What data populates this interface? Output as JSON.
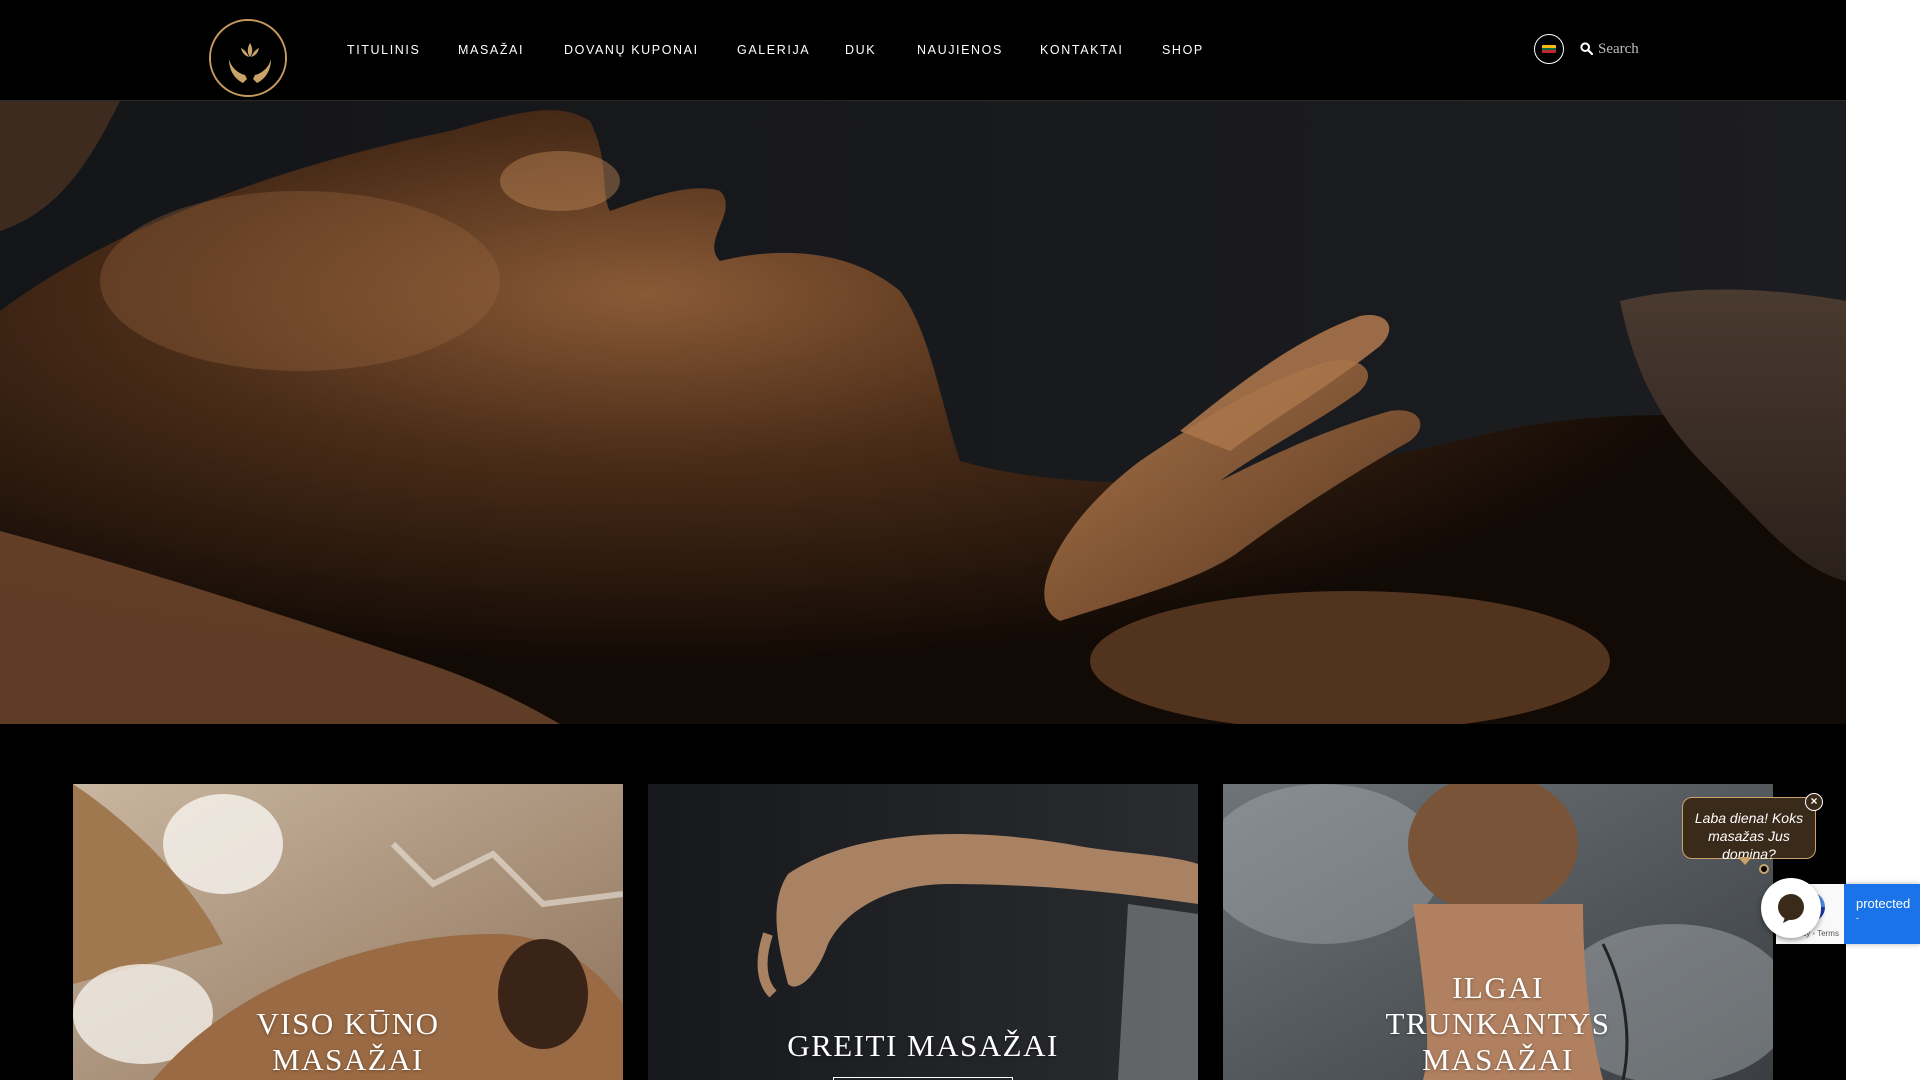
{
  "header": {
    "nav": [
      {
        "label": "TITULINIS"
      },
      {
        "label": "MASAŽAI"
      },
      {
        "label": "DOVANŲ KUPONAI"
      },
      {
        "label": "GALERIJA"
      },
      {
        "label": "DUK"
      },
      {
        "label": "NAUJIENOS"
      },
      {
        "label": "KONTAKTAI"
      },
      {
        "label": "SHOP"
      }
    ],
    "language_flag_colors": [
      "#fdb913",
      "#006a44",
      "#c1272d"
    ],
    "search": {
      "placeholder": "Search",
      "icon": "search-icon"
    },
    "logo_icon": "lotus-hands-icon"
  },
  "colors": {
    "accent_gold": "#c9a36a",
    "background": "#000000",
    "chat_bg": "#3a2a1a",
    "recaptcha_blue": "#1a73e8"
  },
  "cards": [
    {
      "title_lines": [
        "VISO KŪNO",
        "MASAŽAI"
      ]
    },
    {
      "title_lines": [
        "GREITI MASAŽAI"
      ]
    },
    {
      "title_lines": [
        "ILGAI",
        "TRUNKANTYS",
        "MASAŽAI"
      ]
    }
  ],
  "chat": {
    "greeting_lines": [
      "Laba diena! Koks",
      "masažas Jus domina?"
    ],
    "close_symbol": "×",
    "launcher_icon": "chat-bubble-icon"
  },
  "recaptcha": {
    "label": "protected",
    "sub": "-",
    "terms": "Privacy - Terms"
  }
}
